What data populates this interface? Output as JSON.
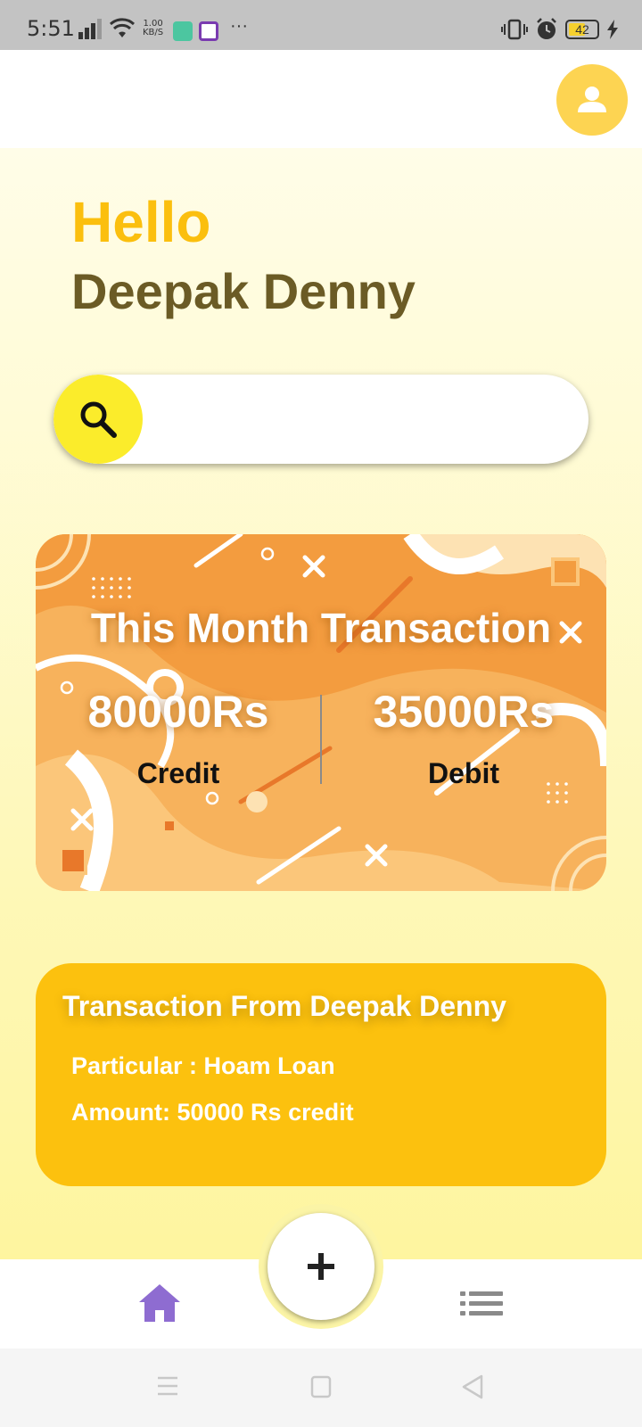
{
  "status_bar": {
    "time": "5:51",
    "speed_value": "1.00",
    "speed_unit": "KB/S",
    "more": "···",
    "battery": "42",
    "icons": [
      "signal-icon",
      "wifi-icon",
      "vibrate-icon",
      "alarm-icon",
      "battery-icon",
      "charging-icon"
    ]
  },
  "profile": {
    "icon": "user-avatar-icon",
    "color": "#fdd452"
  },
  "greeting": {
    "hello": "Hello",
    "name": "Deepak Denny"
  },
  "search": {
    "icon": "search-icon",
    "placeholder": "",
    "value": ""
  },
  "summary_card": {
    "title": "This Month Transaction",
    "credit_amount": "80000Rs",
    "credit_label": "Credit",
    "debit_amount": "35000Rs",
    "debit_label": "Debit"
  },
  "transaction_card": {
    "title": "Transaction From Deepak Denny",
    "particular": "Particular : Hoam Loan",
    "amount": "Amount: 50000 Rs credit",
    "color": "#fcc10e"
  },
  "bottom_nav": {
    "items": [
      "home-icon",
      "list-icon"
    ],
    "fab_icon": "plus-icon",
    "active_color": "#8e6cd1"
  },
  "colors": {
    "accent_yellow": "#fbbf0e",
    "name_brown": "#6b5b25",
    "search_yellow": "#fbec2b"
  }
}
